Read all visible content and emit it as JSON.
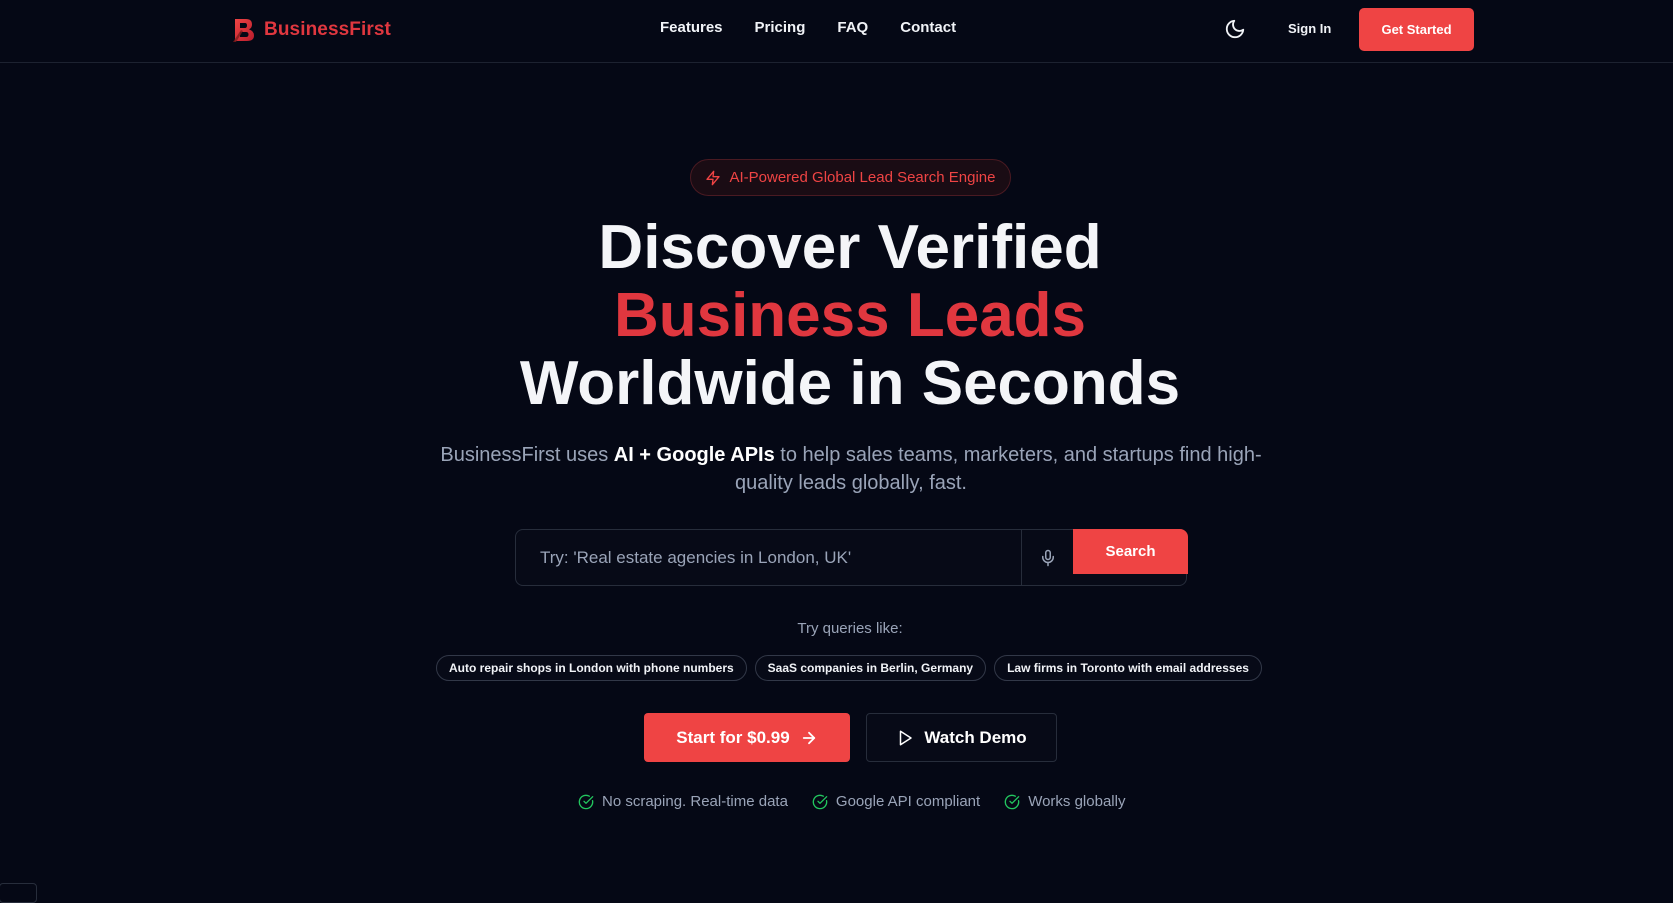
{
  "brand": {
    "name": "BusinessFirst"
  },
  "nav": {
    "links": [
      "Features",
      "Pricing",
      "FAQ",
      "Contact"
    ],
    "sign_in": "Sign In",
    "get_started": "Get Started"
  },
  "hero": {
    "badge": "AI-Powered Global Lead Search Engine",
    "headline_line1": "Discover Verified",
    "headline_accent": "Business Leads",
    "headline_line3": "Worldwide in Seconds",
    "subtitle_prefix": "BusinessFirst uses ",
    "subtitle_strong": "AI + Google APIs",
    "subtitle_suffix": " to help sales teams, marketers, and startups find high-quality leads globally, fast."
  },
  "search": {
    "placeholder": "Try: 'Real estate agencies in London, UK'",
    "value": "",
    "button": "Search"
  },
  "suggestions": {
    "label": "Try queries like:",
    "items": [
      "Auto repair shops in London with phone numbers",
      "SaaS companies in Berlin, Germany",
      "Law firms in Toronto with email addresses"
    ]
  },
  "cta": {
    "primary": "Start for $0.99",
    "secondary": "Watch Demo"
  },
  "features": [
    "No scraping. Real-time data",
    "Google API compliant",
    "Works globally"
  ],
  "colors": {
    "background": "#050815",
    "accent": "#ef4444",
    "brand": "#e0373f",
    "muted_text": "#9aa4b8",
    "success": "#22c55e"
  },
  "icons": {
    "brand": "logo-b-icon",
    "theme": "moon-icon",
    "badge": "lightning-icon",
    "mic": "microphone-icon",
    "cta_primary": "arrow-right-icon",
    "cta_secondary": "play-icon",
    "feature": "check-circle-icon"
  }
}
